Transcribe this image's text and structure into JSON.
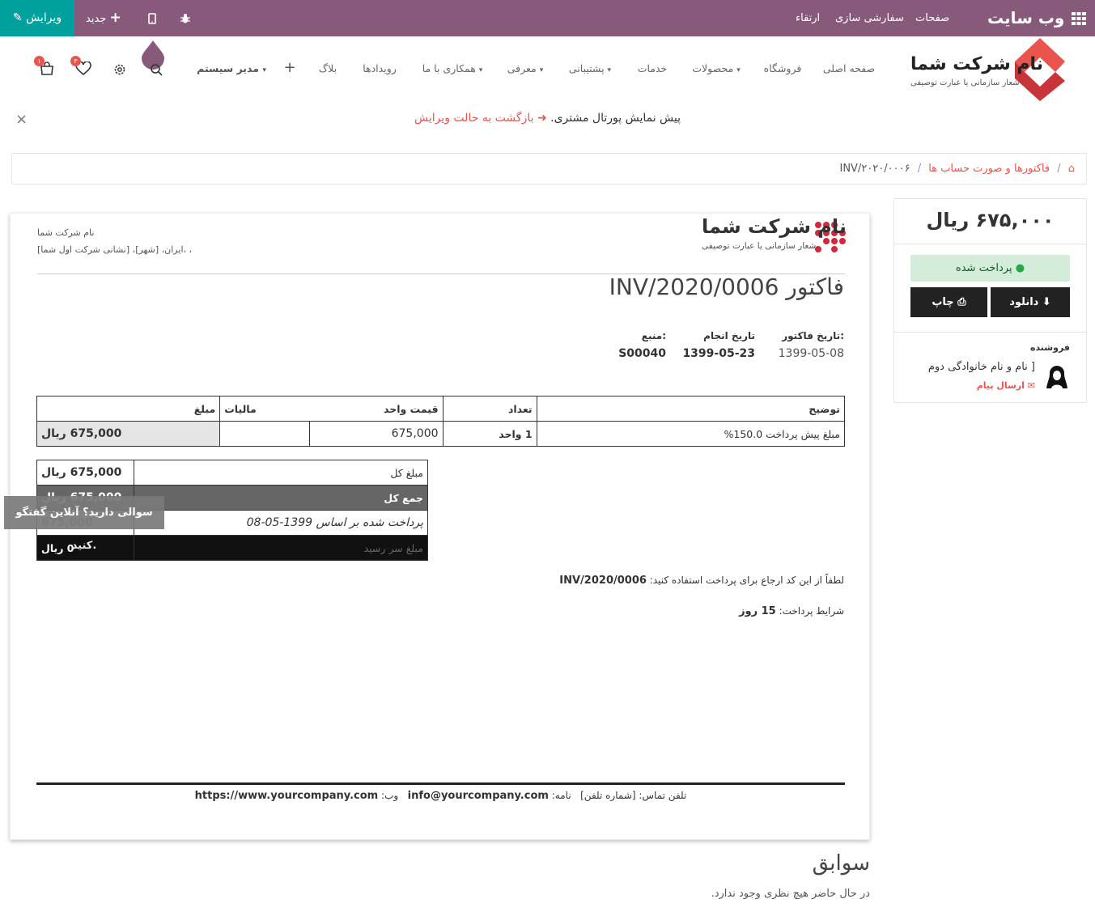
{
  "topbar": {
    "edit_label": "ویرایش",
    "new_label": "جدید",
    "site_title": "وب سایت",
    "pages": "صفحات",
    "customize": "سفارشی سازی",
    "upgrade": "ارتقاء"
  },
  "nav": {
    "brand_name": "نام شرکت شما",
    "brand_tagline": "شعار سازمانی یا عبارت توصیفی",
    "items": [
      "صفحه اصلی",
      "فروشگاه",
      "محصولات",
      "خدمات",
      "پشتیبانی",
      "معرفی",
      "همکاری با ما",
      "رویدادها",
      "بلاگ"
    ],
    "user": "مدیر سیستم",
    "cart_count": "۱",
    "wishlist_count": "۳"
  },
  "preview": {
    "text": "پیش نمایش پورتال مشتری.",
    "back_link": "بازگشت به حالت ویرایش"
  },
  "breadcrumb": {
    "parent": "فاکتورها و صورت حساب ها",
    "current": "INV/۲۰۲۰/۰۰۰۶"
  },
  "invoice": {
    "company_name": "نام شرکت شما",
    "company_tagline": "شعار سازمانی یا عبارت توصیفی",
    "address_line1": "نام شرکت شما",
    "address_line2": "ایران، [شهر]، [نشانی شرکت اول شما]، ،",
    "title": "فاکتور INV/2020/0006",
    "invoice_date_label": "تاریخ فاکتور:",
    "invoice_date": "1399-05-08",
    "due_date_label": "تاریخ انجام",
    "due_date": "1399-05-23",
    "source_label": "منبع:",
    "source": "S00040",
    "columns": [
      "توضیح",
      "تعداد",
      "قیمت واحد",
      "مالیات",
      "مبلغ"
    ],
    "line": {
      "description": "مبلغ پیش پرداخت 150.0%",
      "qty": "1 واحد",
      "unit_price": "675,000",
      "tax": "",
      "amount": "675,000 ریال"
    },
    "totals": {
      "subtotal_label": "مبلغ کل",
      "subtotal": "675,000 ریال",
      "total_label": "جمع کل",
      "total": "675,000 ریال",
      "paid_label": "پرداخت شده بر اساس 1399-05-08",
      "paid": "675,000",
      "due_label": "مبلغ سر رسید",
      "due": "0 ریال"
    },
    "payment_ref_label": "لطفاً از این کد ارجاع برای پرداخت استفاده کنید:",
    "payment_ref": "INV/2020/0006",
    "terms_label": "شرایط پرداخت:",
    "terms": "15 روز",
    "footer_phone": "تلفن تماس: [شماره تلفن]",
    "footer_email_label": "نامه:",
    "footer_email": "info@yourcompany.com",
    "footer_web_label": "وب:",
    "footer_web": "https://www.yourcompany.com"
  },
  "sidebar": {
    "amount": "۶۷۵,۰۰۰ ریال",
    "status": "پرداخت شده",
    "download": "دانلود",
    "print": "چاپ",
    "seller_label": "فروشنده",
    "seller_name": "[ نام و نام خانوادگی دوم",
    "send_message": "ارسال پیام"
  },
  "chat": {
    "text": "سوالی دارید؟ آنلاین گفتگو کنید."
  },
  "history": {
    "title": "سوابق",
    "empty": "در حال حاضر هیچ نظری وجود ندارد."
  }
}
